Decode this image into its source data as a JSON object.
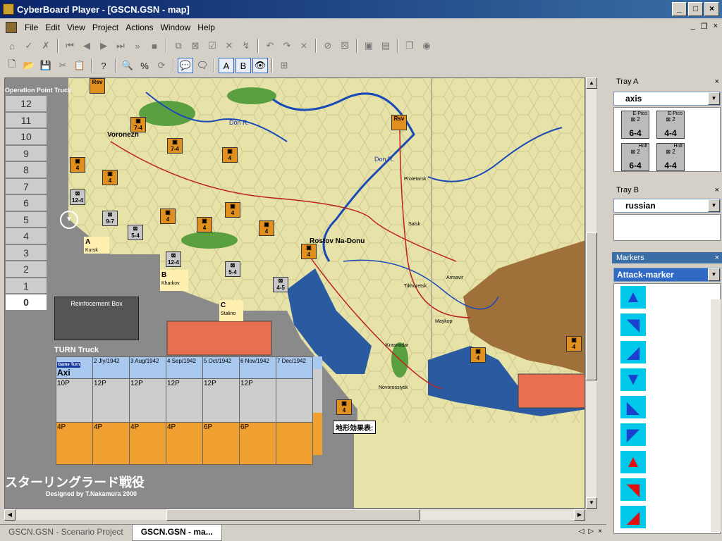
{
  "window": {
    "title": "CyberBoard Player - [GSCN.GSN - map]",
    "minimize": "_",
    "maximize": "□",
    "close": "×"
  },
  "menu": {
    "items": [
      "File",
      "Edit",
      "View",
      "Project",
      "Actions",
      "Window",
      "Help"
    ],
    "mdi": {
      "min": "_",
      "restore": "❐",
      "close": "×"
    }
  },
  "map": {
    "track_title": "Operation Point Truck",
    "track_values": [
      "12",
      "11",
      "10",
      "9",
      "8",
      "7",
      "6",
      "5",
      "4",
      "3",
      "2",
      "1",
      "0"
    ],
    "cities": [
      "Voronezh",
      "Rostov Na-Donu",
      "Kursk",
      "Kharkov",
      "Stalino",
      "Novorossiysk",
      "Krasnodar",
      "Armavir",
      "Maykop",
      "Salsk",
      "Tikhoretsk",
      "Proletarsk"
    ],
    "rivers": [
      "Don R.",
      "Don R."
    ],
    "labels_abc": [
      "A",
      "B",
      "C"
    ],
    "reinforcement_box": "Reinfocement Box",
    "turn_title": "TURN Truck",
    "turn_header_axis": "Axi",
    "turn_columns": [
      "2 Jly/1942",
      "3 Aug/1942",
      "4 Sep/1942",
      "5 Oct/1942",
      "6 Nov/1942",
      "7 Dec/1942"
    ],
    "turn_row1": [
      "10P",
      "12P",
      "12P",
      "12P",
      "12P",
      "12P"
    ],
    "turn_row2": [
      "4P",
      "4P",
      "4P",
      "4P",
      "6P",
      "6P"
    ],
    "jp_title": "スターリングラード戦役",
    "designer": "Designed by T.Nakamura 2000",
    "terrain_title": "地形効果表:",
    "game_turn_label": "Game Turn"
  },
  "tray_a": {
    "title": "Tray A",
    "selected": "axis",
    "counters": [
      {
        "label": "E-Pico",
        "value": "6-4"
      },
      {
        "label": "E-Pico",
        "value": "4-4"
      },
      {
        "label": "Holt",
        "value": "6-4"
      },
      {
        "label": "Holt",
        "value": "4-4"
      }
    ]
  },
  "tray_b": {
    "title": "Tray B",
    "selected": "russian"
  },
  "markers": {
    "title": "Markers",
    "selected": "Attack-marker",
    "arrows": [
      {
        "icon": "arrow-up-icon",
        "glyph": "▲",
        "color": "blue"
      },
      {
        "icon": "arrow-up-right-icon",
        "glyph": "◥",
        "color": "blue"
      },
      {
        "icon": "arrow-down-right-icon",
        "glyph": "◢",
        "color": "blue"
      },
      {
        "icon": "arrow-down-icon",
        "glyph": "▼",
        "color": "blue"
      },
      {
        "icon": "arrow-down-left-icon",
        "glyph": "◣",
        "color": "blue"
      },
      {
        "icon": "arrow-up-left-icon",
        "glyph": "◤",
        "color": "blue"
      },
      {
        "icon": "arrow-up-red-icon",
        "glyph": "▲",
        "color": "red"
      },
      {
        "icon": "arrow-up-right-red-icon",
        "glyph": "◥",
        "color": "red"
      },
      {
        "icon": "arrow-down-right-red-icon",
        "glyph": "◢",
        "color": "red"
      }
    ]
  },
  "tabs": [
    {
      "label": "GSCN.GSN - Scenario Project",
      "active": false
    },
    {
      "label": "GSCN.GSN - ma...",
      "active": true
    }
  ]
}
